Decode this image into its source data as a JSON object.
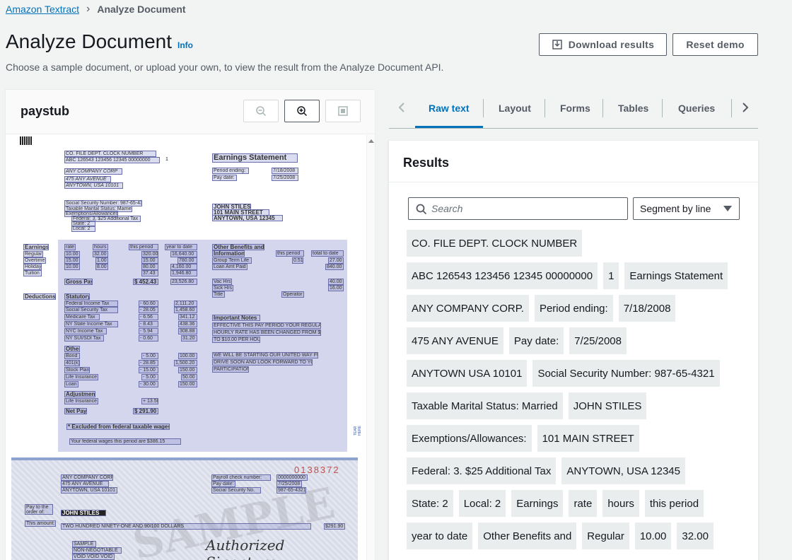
{
  "breadcrumb": {
    "root": "Amazon Textract",
    "current": "Analyze Document"
  },
  "page": {
    "title": "Analyze Document",
    "info": "Info",
    "subtitle": "Choose a sample document, or upload your own, to view the result from the Analyze Document API."
  },
  "actions": {
    "download": "Download results",
    "reset": "Reset demo"
  },
  "document": {
    "name": "paystub",
    "tools": [
      "zoom-out-icon",
      "zoom-in-icon",
      "fit-page-icon"
    ],
    "stub": {
      "header": "CO.   FILE   DEPT.  CLOCK NUMBER",
      "header_values": "ABC  126543  123456  12345  00000000",
      "header_one": "1",
      "company": [
        "ANY COMPANY CORP",
        "475 ANY AVENUE",
        "ANYTOWN, USA 10101"
      ],
      "statement_title": "Earnings Statement",
      "period_label": "Period ending:",
      "period_value": "7/18/2008",
      "pay_label": "Pay date:",
      "pay_value": "7/25/2008",
      "ssn": "Social Security Number: 987-65-4321",
      "marital": "Taxable Marital Status: Married",
      "exemptions": "Exemptions/Allowances:",
      "federal": "Federal:  3, $25 Additional Tax",
      "state": "State:  2",
      "local": "Local:  2",
      "employee": [
        "JOHN STILES",
        "101 MAIN STREET",
        "ANYTOWN, USA 12345"
      ],
      "earnings_hdr": [
        "Earnings",
        "rate",
        "hours",
        "this period",
        "year to date"
      ],
      "earnings_rows": [
        [
          "Regular",
          "10.00",
          "32.00",
          "320.00",
          "16,640.00"
        ],
        [
          "Overtime",
          "15.00",
          "1.00",
          "15.00",
          "780.00"
        ],
        [
          "Holiday",
          "10.00",
          "8.00",
          "80.00",
          "4,160.00"
        ],
        [
          "Tuition",
          "",
          "",
          "37.43",
          "1,946.80"
        ]
      ],
      "gross_label": "Gross Pay",
      "gross_value": "$ 452.43",
      "gross_ytd": "23,526.80",
      "deductions_label": "Deductions",
      "statutory": "Statutory",
      "statutory_rows": [
        [
          "Federal Income Tax",
          "- 60.60",
          "2,111.20"
        ],
        [
          "Social Security Tax",
          "- 28.05",
          "1,458.60"
        ],
        [
          "Medicare Tax",
          "- 6.56",
          "341.12"
        ],
        [
          "NY State Income Tax",
          "- 8.43",
          "438.36"
        ],
        [
          "NYC Income Tax",
          "- 5.94",
          "308.88"
        ],
        [
          "NY SUI/SDI Tax",
          "- 0.60",
          "31.20"
        ]
      ],
      "other": "Other",
      "other_rows": [
        [
          "Bond",
          "- 5.00",
          "100.00"
        ],
        [
          "401(k)",
          "- 28.85",
          "1,500.20"
        ],
        [
          "Stock Plan",
          "- 15.00",
          "150.00"
        ],
        [
          "Life Insurance",
          "- 5.00",
          "50.00"
        ],
        [
          "Loan",
          "- 30.00",
          "150.00"
        ]
      ],
      "adjustment": "Adjustment",
      "adj_row": [
        "Life Insurance",
        "+ 13.50"
      ],
      "net_label": "Net Pay",
      "net_value": "$ 291.90",
      "excluded": "* Excluded from federal taxable wages",
      "fed_wages": "Your federal wages this period are $386.15",
      "other_benefits": "Other Benefits and",
      "information": "Information",
      "ob_cols": [
        "this period",
        "total to date"
      ],
      "ob_rows": [
        [
          "Group Term Life",
          "0.51",
          "27.00"
        ],
        [
          "Loan Amt Paid",
          "",
          "840.00"
        ],
        [
          "Vac Hrs",
          "",
          "40.00"
        ],
        [
          "Sick Hrs",
          "",
          "16.00"
        ],
        [
          "Title",
          "Operator",
          ""
        ]
      ],
      "notes_title": "Important Notes",
      "notes": [
        "EFFECTIVE THIS PAY PERIOD YOUR REGULAR",
        "HOURLY RATE HAS BEEN CHANGED FROM $8.00",
        "TO $10.00 PER HOUR.",
        "WE WILL BE STARTING OUR UNITED WAY FUND",
        "DRIVE SOON AND LOOK FORWARD TO YOUR",
        "PARTICIPATION."
      ],
      "tear": "TEAR HERE"
    },
    "check": {
      "company": [
        "ANY COMPANY CORP",
        "475 ANY AVENUE",
        "ANYTOWN, USA 10101"
      ],
      "number": "0138372",
      "payroll_label": "Payroll check number:",
      "payroll_value": "0000000000",
      "pay_date_label": "Pay date:",
      "pay_date_value": "7/25/2008",
      "ssn_label": "Social Security No.",
      "ssn_value": "987-65-4321",
      "payto": "Pay to the order of:",
      "payee": "JOHN STILES",
      "amount_label": "This amount:",
      "amount_words": "TWO HUNDRED NINETY-ONE AND 90/100 DOLLARS",
      "amount": "$291.90",
      "watermark": "SAMPLE",
      "sample": [
        "SAMPLE",
        "NON-NEGOTIABLE",
        "VOID VOID VOID"
      ],
      "signature": "Authorized Signature"
    }
  },
  "tabs": [
    "Raw text",
    "Layout",
    "Forms",
    "Tables",
    "Queries"
  ],
  "results": {
    "title": "Results",
    "search_placeholder": "Search",
    "segment": "Segment by line",
    "chips": [
      [
        "CO. FILE DEPT. CLOCK NUMBER"
      ],
      [
        "ABC 126543 123456 12345 00000000",
        "1",
        "Earnings Statement"
      ],
      [
        "ANY COMPANY CORP.",
        "Period ending:",
        "7/18/2008"
      ],
      [
        "475 ANY AVENUE",
        "Pay date:",
        "7/25/2008"
      ],
      [
        "ANYTOWN USA 10101",
        "Social Security Number: 987-65-4321"
      ],
      [
        "Taxable Marital Status: Married",
        "JOHN STILES"
      ],
      [
        "Exemptions/Allowances:",
        "101 MAIN STREET"
      ],
      [
        "Federal: 3. $25 Additional Tax",
        "ANYTOWN, USA 12345"
      ],
      [
        "State: 2",
        "Local: 2",
        "Earnings",
        "rate",
        "hours",
        "this period"
      ],
      [
        "year to date",
        "Other Benefits and",
        "Regular",
        "10.00",
        "32.00"
      ]
    ]
  },
  "colors": {
    "link": "#0073bb",
    "text": "#16191f",
    "muted": "#545b64",
    "chip": "#eaeded",
    "highlight": "#d4d6ee"
  }
}
